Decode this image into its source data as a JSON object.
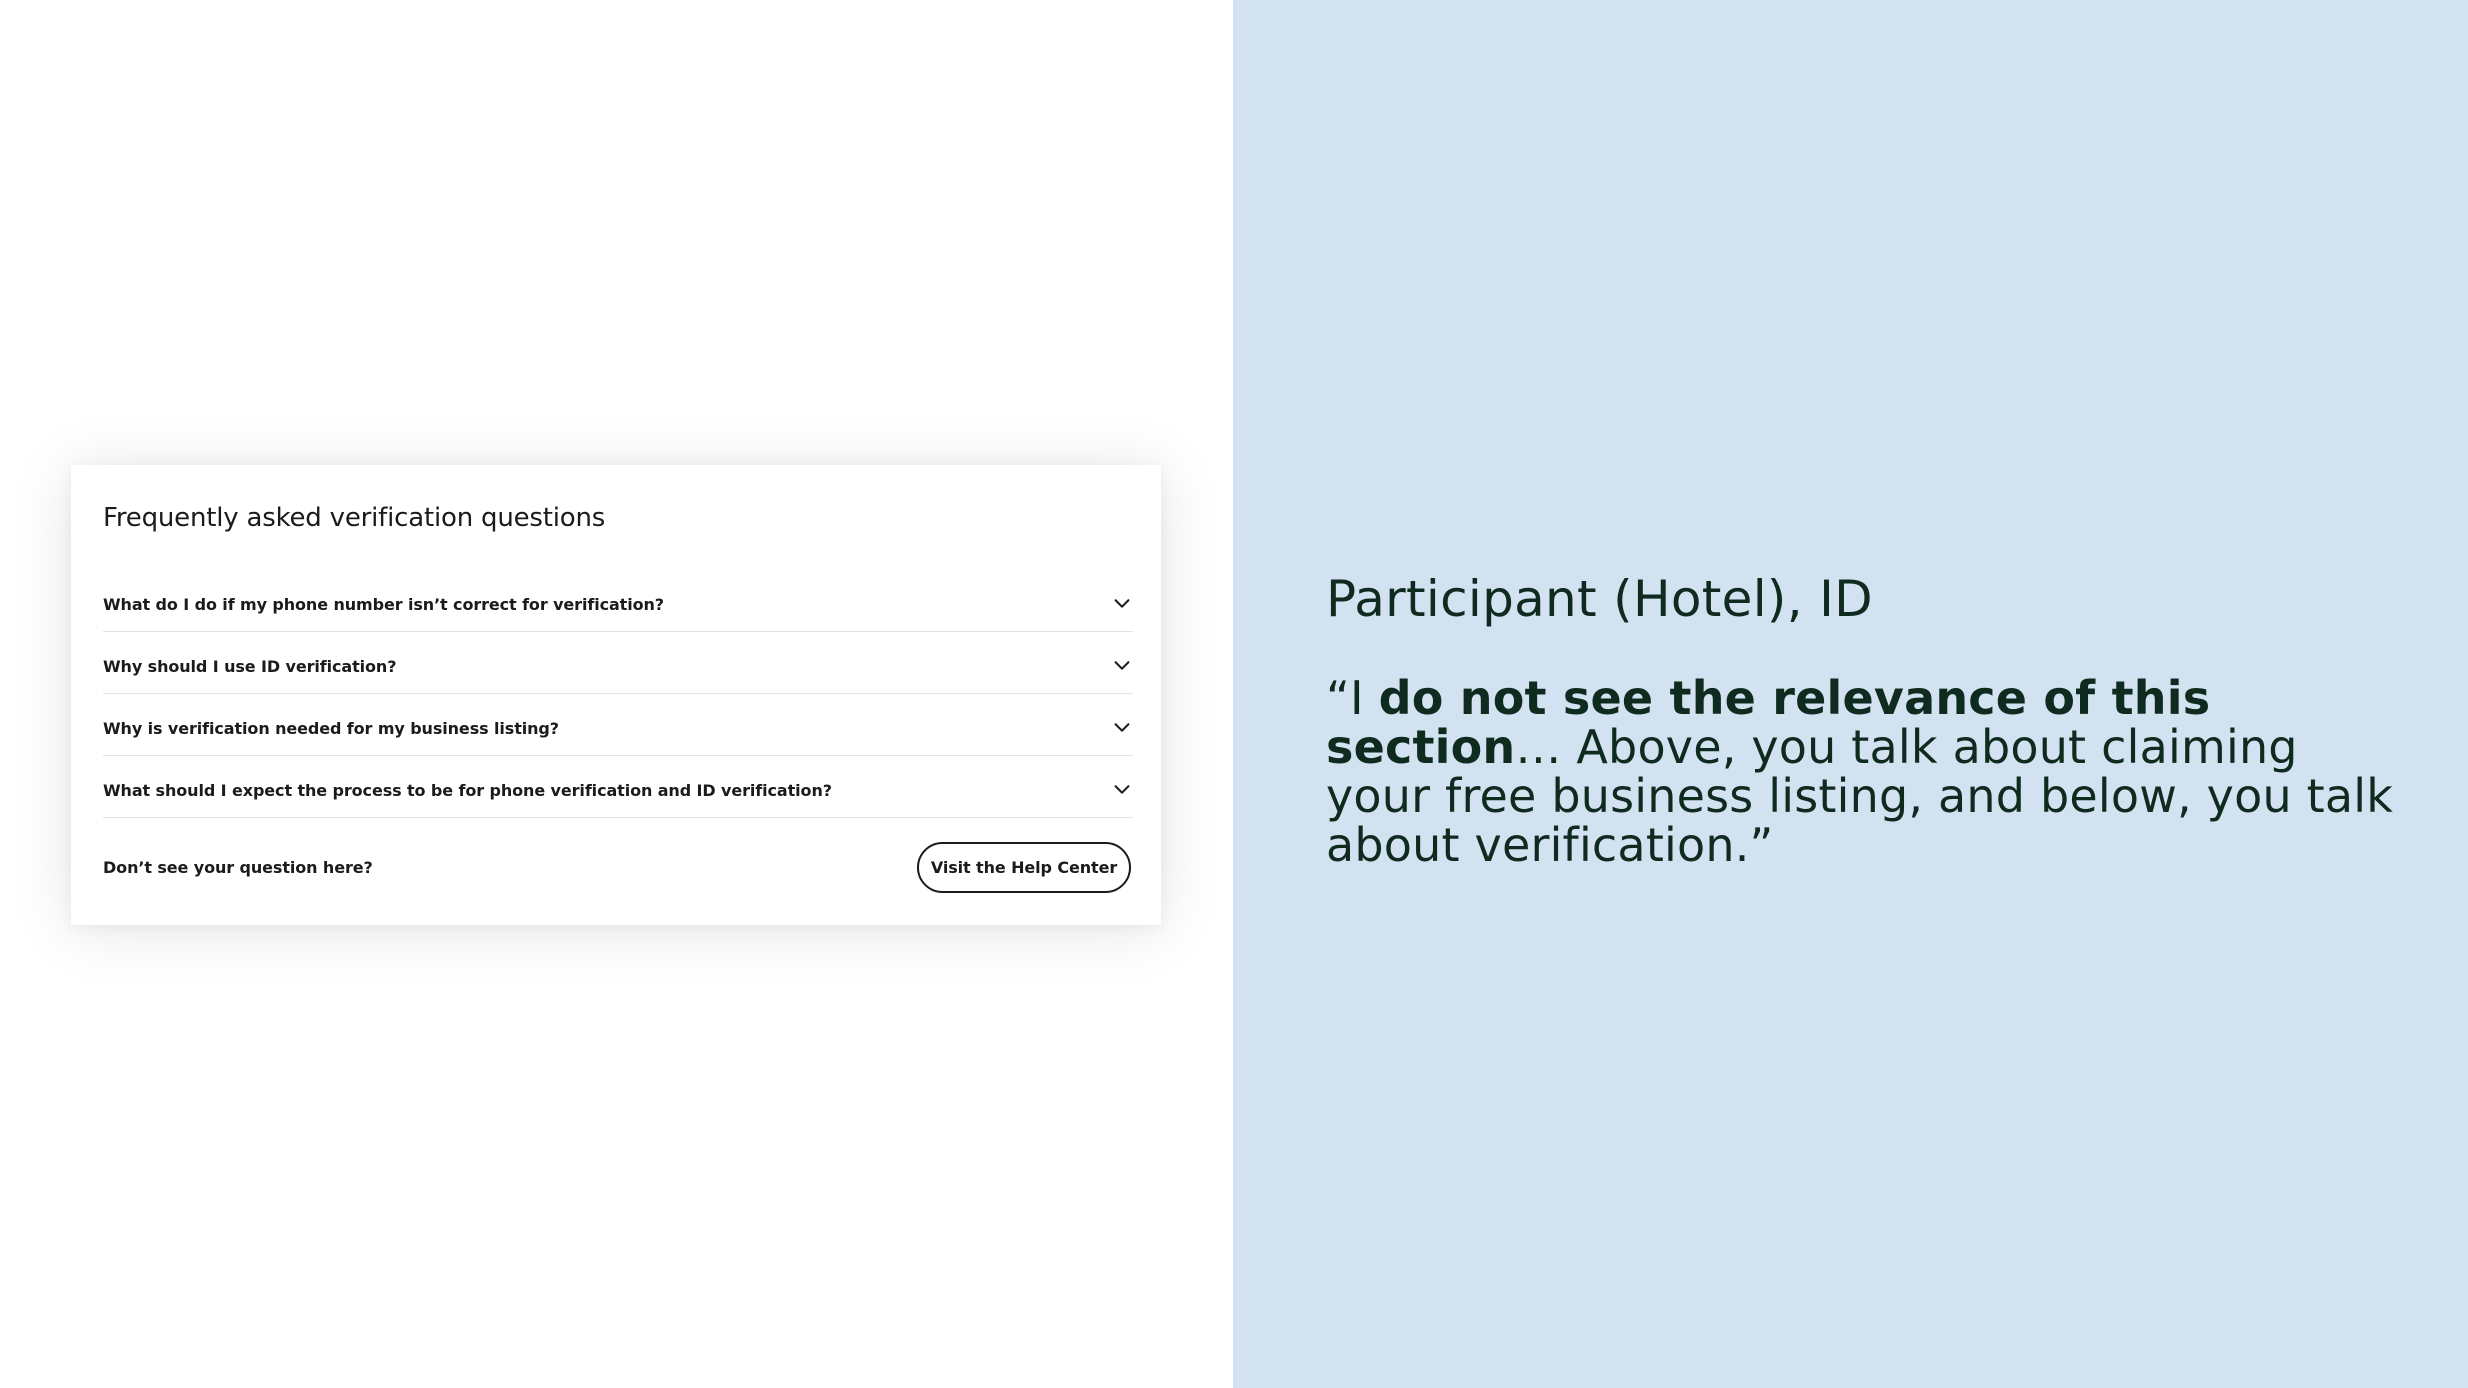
{
  "faq": {
    "title": "Frequently asked verification questions",
    "items": [
      {
        "question": "What do I do if my phone number isn’t correct for verification?",
        "icon": "chevron-down-icon"
      },
      {
        "question": "Why should I use ID verification?",
        "icon": "chevron-down-icon"
      },
      {
        "question": "Why is verification needed for my business listing?",
        "icon": "chevron-down-icon"
      },
      {
        "question": "What should I expect the process to be for phone verification and ID verification?",
        "icon": "chevron-down-icon"
      }
    ],
    "footer_text": "Don’t see your question here?",
    "help_button_label": "Visit the Help Center"
  },
  "feedback": {
    "participant": "Participant (Hotel), ID",
    "quote_open": "“I ",
    "quote_bold": "do not see the relevance of this section",
    "quote_rest": "… Above, you talk about claiming your free business listing, and below, you talk about verification.”"
  },
  "colors": {
    "right_panel_bg": "#d3e2f0",
    "quote_text": "#0f2a1f",
    "card_text": "#1b1b1b"
  }
}
